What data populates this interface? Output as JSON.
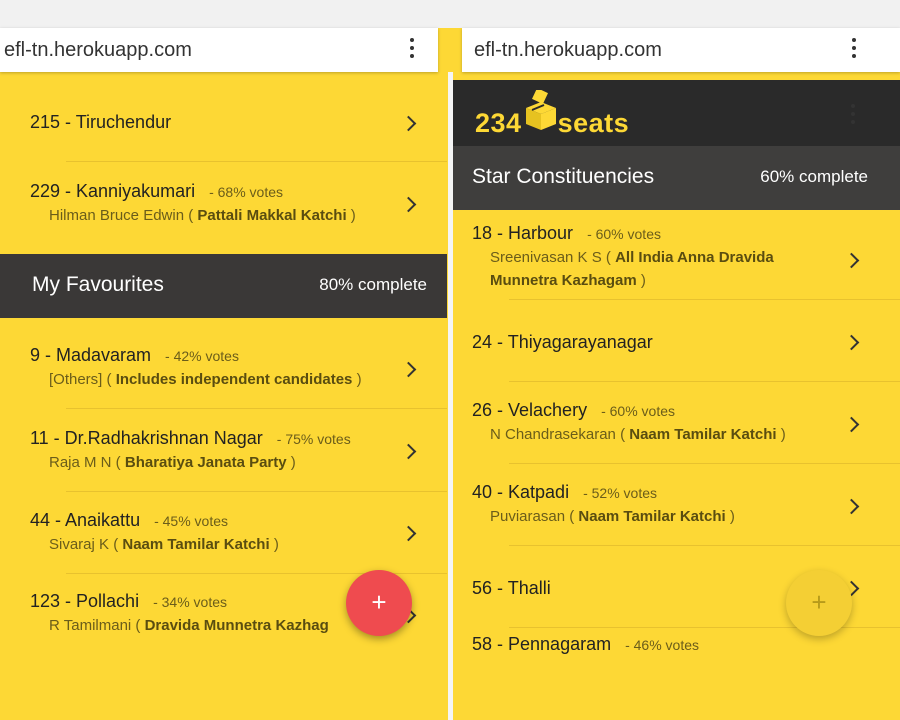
{
  "colors": {
    "accent": "#fdd835",
    "header": "#3a3837",
    "fab": "#ef4b4f"
  },
  "left": {
    "url": "efl-tn.herokuapp.com",
    "rows_top": [
      {
        "title": "215 - Tiruchendur"
      },
      {
        "title": "229 - Kanniyakumari",
        "votes": "- 68% votes",
        "candidate": "Hilman Bruce Edwin (",
        "party": "Pattali Makkal Katchi",
        "close": ")"
      }
    ],
    "section": {
      "name": "My Favourites",
      "percent": "80% complete"
    },
    "rows": [
      {
        "title": "9 - Madavaram",
        "votes": "- 42% votes",
        "candidate": "[Others] (",
        "party": "Includes independent candidates",
        "close": ")"
      },
      {
        "title": "11 - Dr.Radhakrishnan Nagar",
        "votes": "- 75% votes",
        "candidate": "Raja M N (",
        "party": "Bharatiya Janata Party",
        "close": ")"
      },
      {
        "title": "44 - Anaikattu",
        "votes": "- 45% votes",
        "candidate": "Sivaraj K (",
        "party": "Naam Tamilar Katchi",
        "close": ")"
      },
      {
        "title": "123 - Pollachi",
        "votes": "- 34% votes",
        "candidate": "R Tamilmani (",
        "party": "Dravida Munnetra Kazhag",
        "close": ""
      }
    ],
    "fab": "+"
  },
  "right": {
    "url": "efl-tn.herokuapp.com",
    "logo": {
      "number": "234",
      "word": "seats"
    },
    "section": {
      "name": "Star Constituencies",
      "percent": "60% complete"
    },
    "rows": [
      {
        "title": "18 - Harbour",
        "votes": "- 60% votes",
        "candidate": "Sreenivasan K S (",
        "party": "All India Anna Dravida",
        "party2": "Munnetra Kazhagam",
        "close": ")"
      },
      {
        "title": "24 - Thiyagarayanagar"
      },
      {
        "title": "26 - Velachery",
        "votes": "- 60% votes",
        "candidate": "N Chandrasekaran (",
        "party": "Naam Tamilar Katchi",
        "close": ")"
      },
      {
        "title": "40 - Katpadi",
        "votes": "- 52% votes",
        "candidate": "Puviarasan (",
        "party": "Naam Tamilar Katchi",
        "close": ")"
      },
      {
        "title": "56 - Thalli"
      },
      {
        "title": "58 - Pennagaram",
        "votes": "- 46% votes"
      }
    ],
    "fab": "+"
  }
}
